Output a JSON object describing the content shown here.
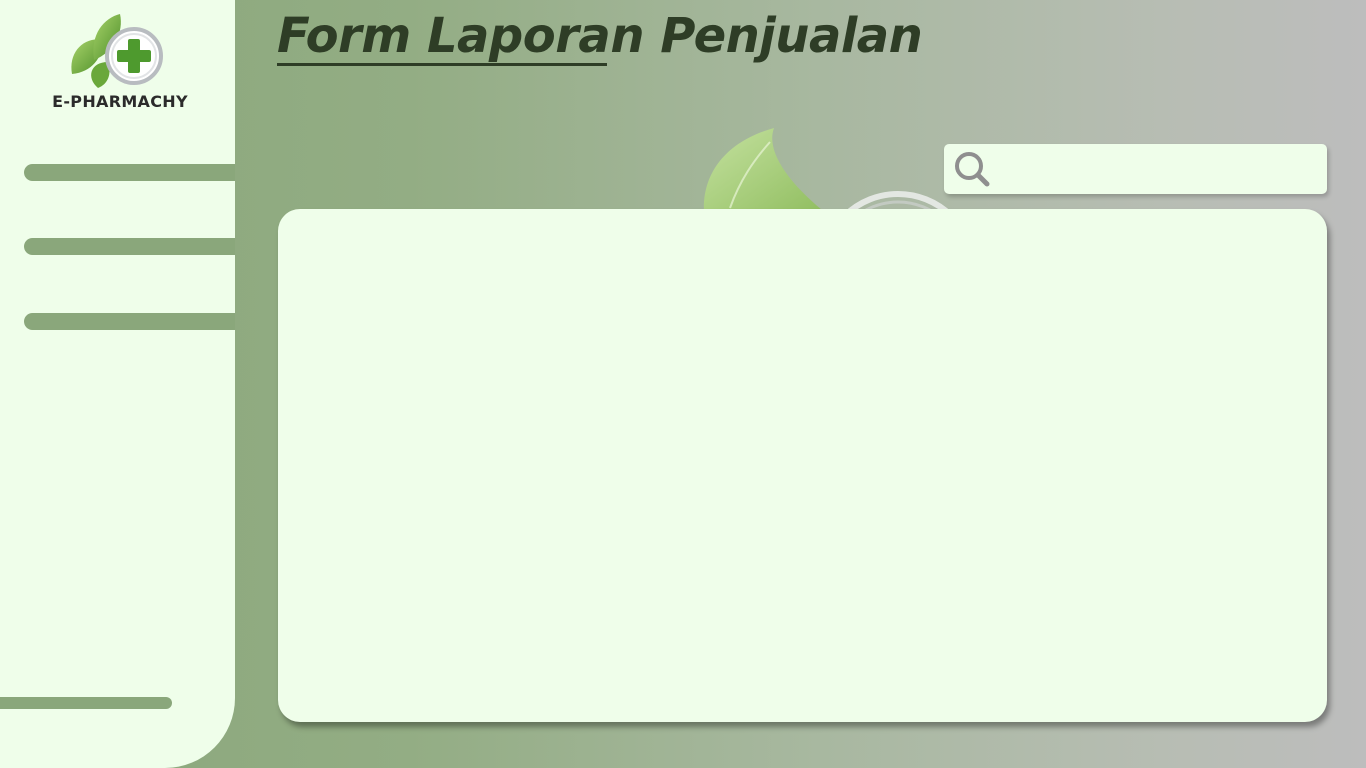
{
  "app": {
    "logo_text": "E-PHARMACHY"
  },
  "header": {
    "title": "Form Laporan Penjualan"
  },
  "search": {
    "value": "",
    "placeholder": ""
  },
  "sidebar": {
    "nav_items": [
      {
        "label": ""
      },
      {
        "label": ""
      },
      {
        "label": ""
      }
    ],
    "bottom_item": {
      "label": ""
    }
  },
  "colors": {
    "sidebar_bg": "#effeea",
    "accent_green": "#8aa77b",
    "title_color": "#2e3d26",
    "panel_bg": "#effeea"
  },
  "icons": {
    "logo": "pharmacy-leaf-cross-icon",
    "search": "search-icon"
  }
}
